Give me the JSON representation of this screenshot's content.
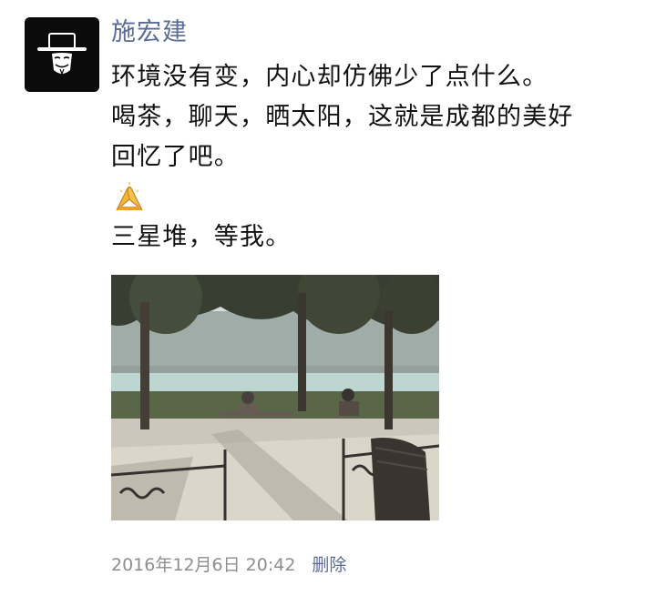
{
  "post": {
    "author": "施宏建",
    "lines": [
      "环境没有变，内心却仿佛少了点什么。",
      "喝茶，聊天，晒太阳，这就是成都的美好",
      "回忆了吧。"
    ],
    "emoji": "praying-hands-emoji",
    "closing_line": "三星堆，等我。",
    "timestamp": "2016年12月6日 20:42",
    "delete_label": "删除"
  },
  "icons": {
    "avatar": "masked-face-with-hat-icon"
  },
  "colors": {
    "author_name": "#5a6c97",
    "body_text": "#111111",
    "meta_text": "#8e8e8e",
    "link": "#5a6c97"
  }
}
